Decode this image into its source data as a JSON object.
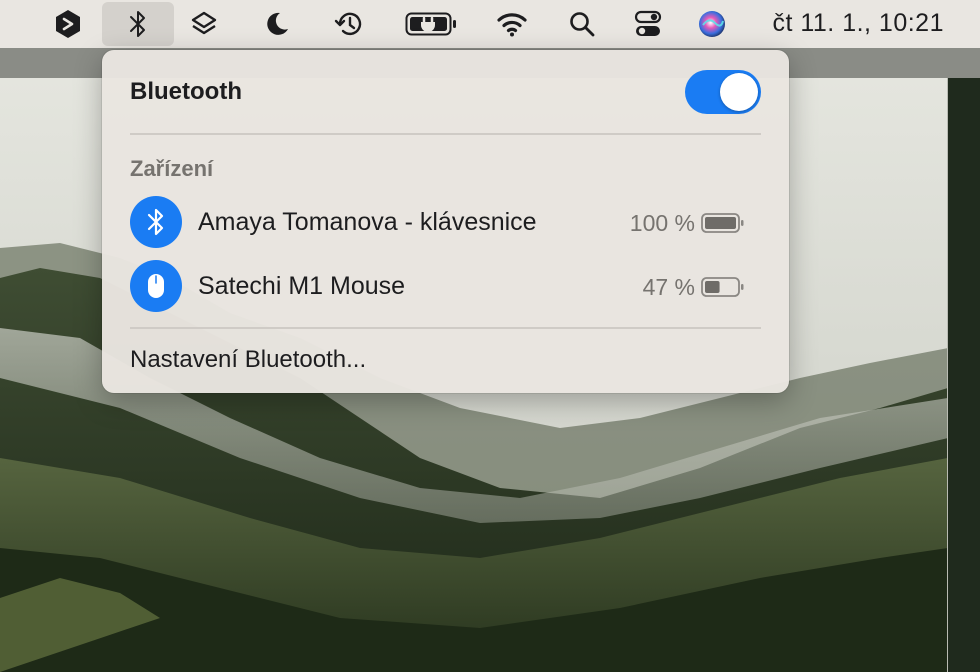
{
  "menubar": {
    "items": [
      {
        "icon": "app-logo-icon"
      },
      {
        "icon": "bluetooth-icon",
        "active": true
      },
      {
        "icon": "layers-icon"
      },
      {
        "icon": "moon-icon"
      },
      {
        "icon": "time-machine-icon"
      },
      {
        "icon": "battery-charging-icon"
      },
      {
        "icon": "wifi-icon"
      },
      {
        "icon": "search-icon"
      },
      {
        "icon": "control-center-icon"
      },
      {
        "icon": "siri-icon"
      }
    ],
    "clock": "čt 11. 1., 10:21"
  },
  "bluetooth_panel": {
    "title": "Bluetooth",
    "toggle_on": true,
    "section_label": "Zařízení",
    "devices": [
      {
        "name": "Amaya Tomanova - klávesnice",
        "battery_text": "100 %",
        "battery_level": 1.0,
        "icon": "bluetooth-icon"
      },
      {
        "name": "Satechi M1 Mouse",
        "battery_text": "47 %",
        "battery_level": 0.47,
        "icon": "mouse-icon"
      }
    ],
    "settings_label": "Nastavení Bluetooth..."
  },
  "colors": {
    "accent": "#1a7cf3",
    "menubar_bg": "#e9e6e1",
    "panel_bg": "#e9e5e0",
    "secondary_text": "#76736f"
  }
}
